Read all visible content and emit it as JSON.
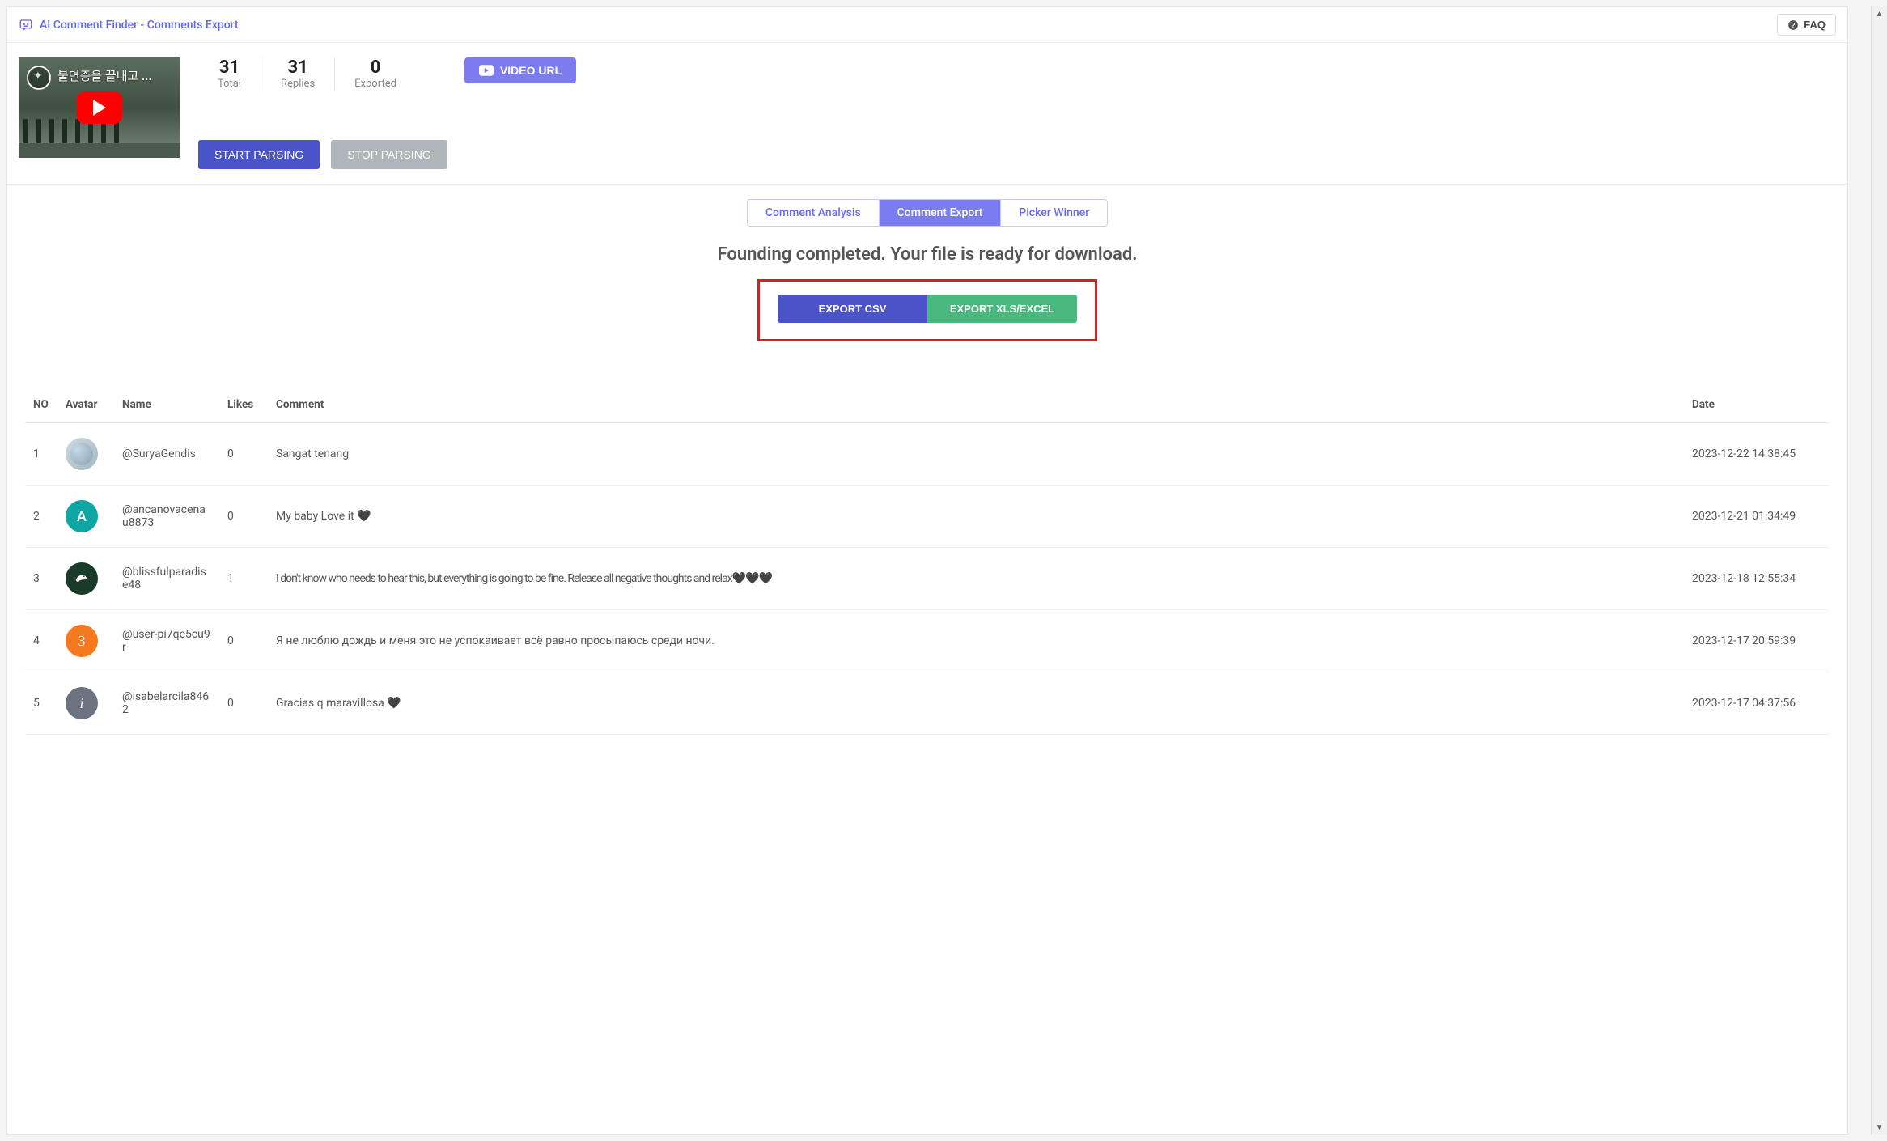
{
  "header": {
    "title": "AI Comment Finder - Comments Export",
    "faq_label": "FAQ"
  },
  "thumb": {
    "overlay_title": "불면증을 끝내고 ..."
  },
  "stats": {
    "total_num": "31",
    "total_label": "Total",
    "replies_num": "31",
    "replies_label": "Replies",
    "exported_num": "0",
    "exported_label": "Exported"
  },
  "buttons": {
    "video_url": "VIDEO URL",
    "start_parsing": "START PARSING",
    "stop_parsing": "STOP PARSING",
    "export_csv": "EXPORT CSV",
    "export_xls": "EXPORT XLS/EXCEL"
  },
  "tabs": {
    "analysis": "Comment Analysis",
    "export": "Comment Export",
    "picker": "Picker Winner"
  },
  "status_msg": "Founding completed. Your file is ready for download.",
  "table": {
    "headers": {
      "no": "NO",
      "avatar": "Avatar",
      "name": "Name",
      "likes": "Likes",
      "comment": "Comment",
      "date": "Date"
    },
    "rows": [
      {
        "no": "1",
        "avatar_letter": "",
        "name": "@SuryaGendis",
        "likes": "0",
        "comment": "Sangat tenang",
        "date": "2023-12-22 14:38:45"
      },
      {
        "no": "2",
        "avatar_letter": "A",
        "name": "@ancanovacenau8873",
        "likes": "0",
        "comment": "My baby Love it 🖤",
        "date": "2023-12-21 01:34:49"
      },
      {
        "no": "3",
        "avatar_letter": "",
        "name": "@blissfulparadise48",
        "likes": "1",
        "comment": "I don't know who needs to hear this, but everything is going to be fine. Release all negative thoughts and relax🖤🖤🖤",
        "date": "2023-12-18 12:55:34"
      },
      {
        "no": "4",
        "avatar_letter": "З",
        "name": "@user-pi7qc5cu9r",
        "likes": "0",
        "comment": "Я не люблю дождь и меня это не успокаивает всё равно просыпаюсь среди ночи.",
        "date": "2023-12-17 20:59:39"
      },
      {
        "no": "5",
        "avatar_letter": "i",
        "name": "@isabelarcila8462",
        "likes": "0",
        "comment": "Gracias q maravillosa 🖤",
        "date": "2023-12-17 04:37:56"
      }
    ]
  }
}
